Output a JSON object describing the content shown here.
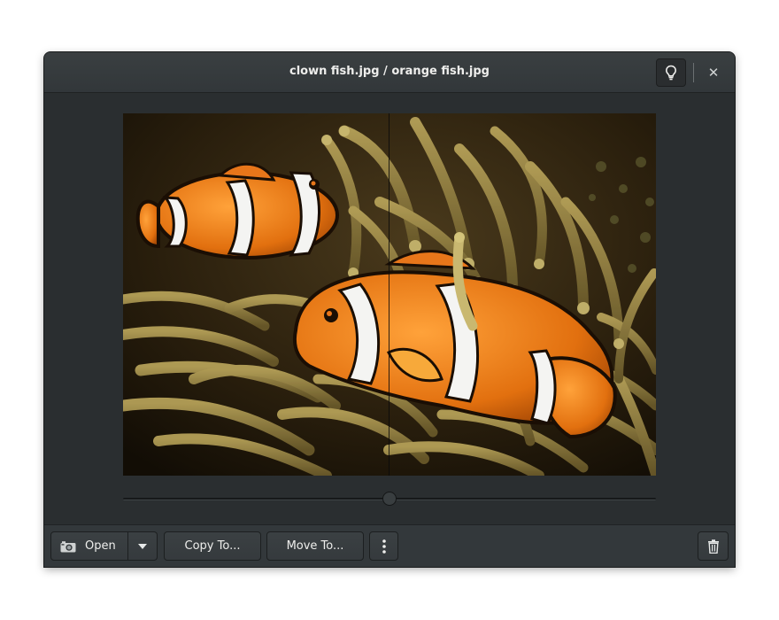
{
  "window": {
    "title": "clown fish.jpg / orange fish.jpg"
  },
  "titlebar": {
    "hint_icon": "lightbulb-icon",
    "close_icon": "close-icon",
    "close_glyph": "✕"
  },
  "comparison": {
    "divider_position": 0.5
  },
  "toolbar": {
    "open_label": "Open",
    "open_icon": "camera-icon",
    "open_menu_icon": "chevron-down-icon",
    "copy_label": "Copy To...",
    "move_label": "Move To...",
    "more_icon": "vertical-dots-icon",
    "trash_icon": "trash-icon"
  },
  "colors": {
    "window_bg": "#2a2e30",
    "titlebar_bg": "#363b3e",
    "text": "#eeeeec",
    "fish_orange": "#e8761a"
  }
}
